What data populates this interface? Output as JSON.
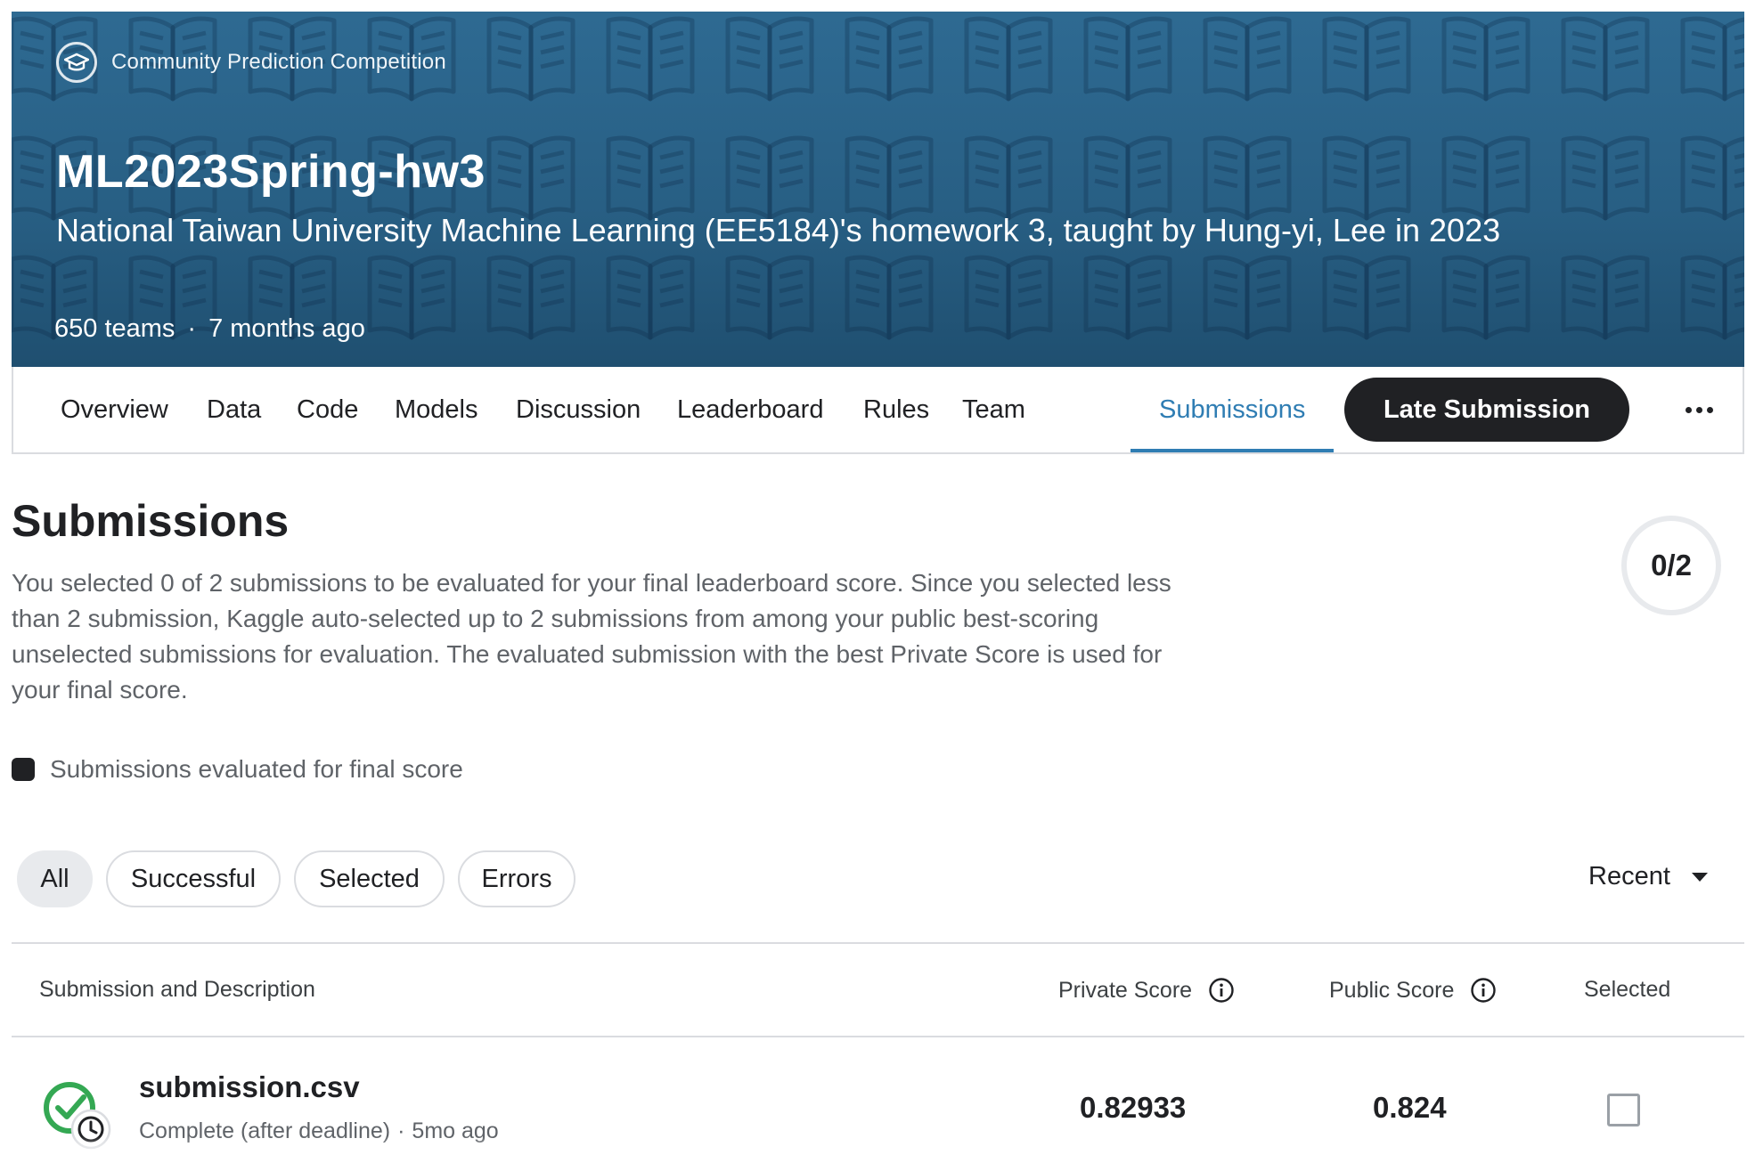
{
  "banner": {
    "type_label": "Community Prediction Competition",
    "type_icon": "graduation-cap-icon",
    "title": "ML2023Spring-hw3",
    "subtitle": "National Taiwan University Machine Learning (EE5184)'s homework 3, taught by Hung-yi, Lee in 2023",
    "teams": "650 teams",
    "separator": "·",
    "age": "7 months ago",
    "colors": {
      "background": "#285f84",
      "pattern_icon": "open-book-icon"
    }
  },
  "tabs": [
    {
      "label": "Overview"
    },
    {
      "label": "Data"
    },
    {
      "label": "Code"
    },
    {
      "label": "Models"
    },
    {
      "label": "Discussion"
    },
    {
      "label": "Leaderboard"
    },
    {
      "label": "Rules"
    },
    {
      "label": "Team"
    },
    {
      "label": "Submissions",
      "active": true
    }
  ],
  "toolbar": {
    "late_submission_label": "Late Submission",
    "more_icon": "more-horizontal-icon"
  },
  "submissions": {
    "title": "Submissions",
    "intro": "You selected 0 of 2 submissions to be evaluated for your final leaderboard score. Since you selected less than 2 submission, Kaggle auto-selected up to 2 submissions from among your public best-scoring unselected submissions for evaluation. The evaluated submission with the best Private Score is used for your final score.",
    "counter": "0/2",
    "legend_label": "Submissions evaluated for final score"
  },
  "filters": {
    "chips": [
      {
        "label": "All",
        "active": true
      },
      {
        "label": "Successful"
      },
      {
        "label": "Selected"
      },
      {
        "label": "Errors"
      }
    ],
    "sort_label": "Recent"
  },
  "table": {
    "headers": {
      "submission": "Submission and Description",
      "private_score": "Private Score",
      "public_score": "Public Score",
      "selected": "Selected"
    },
    "rows": [
      {
        "file": "submission.csv",
        "status": "Complete (after deadline)",
        "separator": "·",
        "age": "5mo ago",
        "private_score": "0.82933",
        "public_score": "0.824",
        "selected": false,
        "status_icon": "check-circle-clock-icon"
      }
    ]
  },
  "colors": {
    "accent": "#2f7db3",
    "success": "#34a853",
    "dark": "#202124"
  }
}
